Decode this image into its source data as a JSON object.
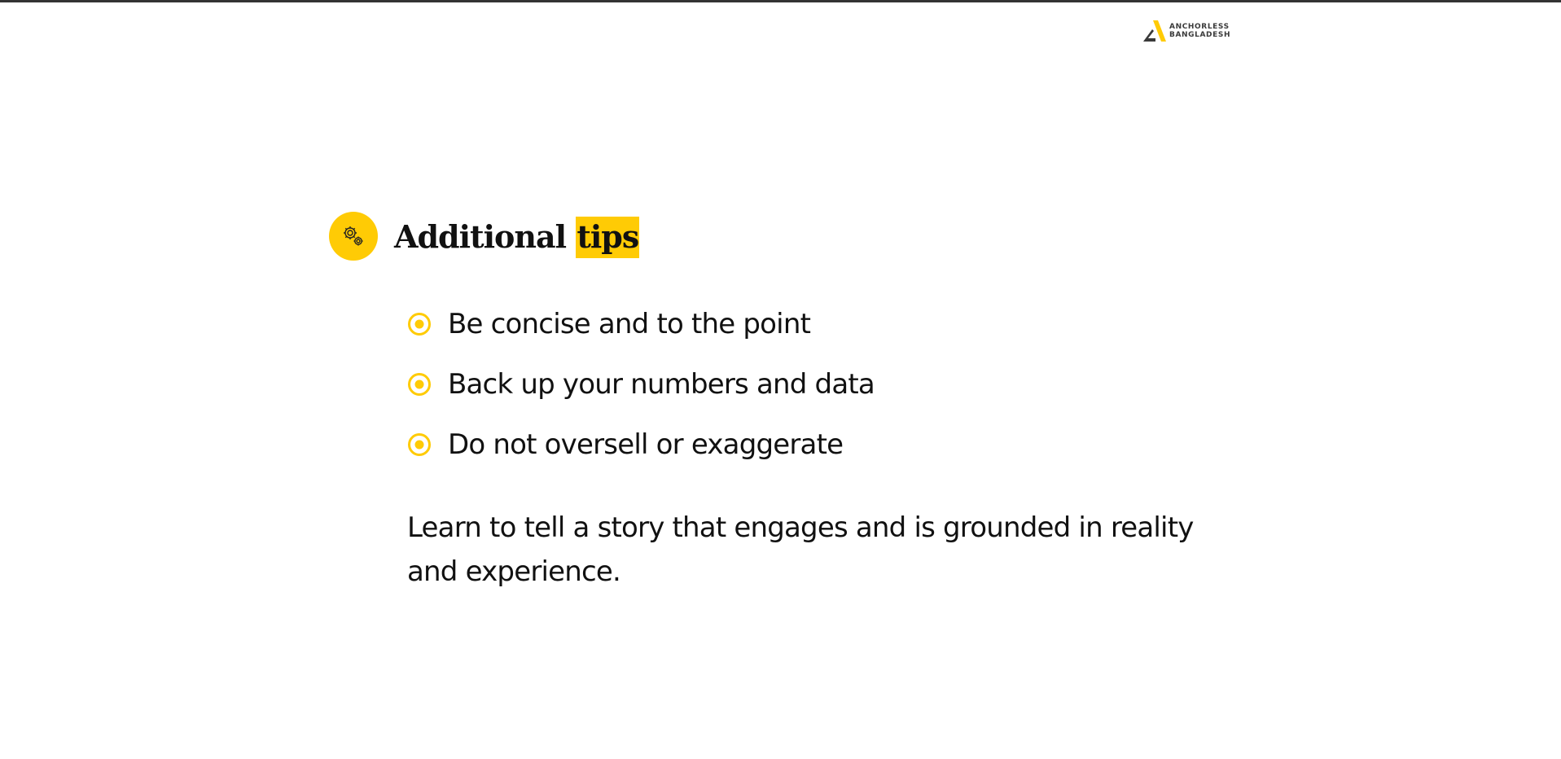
{
  "brand": {
    "logo_line1": "ANCHORLESS",
    "logo_line2": "BANGLADESH",
    "accent_color": "#FFCB05"
  },
  "heading": {
    "icon": "gears-icon",
    "title_part1": "Additional ",
    "title_highlight": "tips"
  },
  "tips": [
    {
      "text": "Be concise and to the point",
      "icon": "radio-bullet-icon"
    },
    {
      "text": "Back up your numbers and data",
      "icon": "radio-bullet-icon"
    },
    {
      "text": "Do not oversell or exaggerate",
      "icon": "radio-bullet-icon"
    }
  ],
  "summary": "Learn to tell a story that engages and is grounded in reality and experience."
}
